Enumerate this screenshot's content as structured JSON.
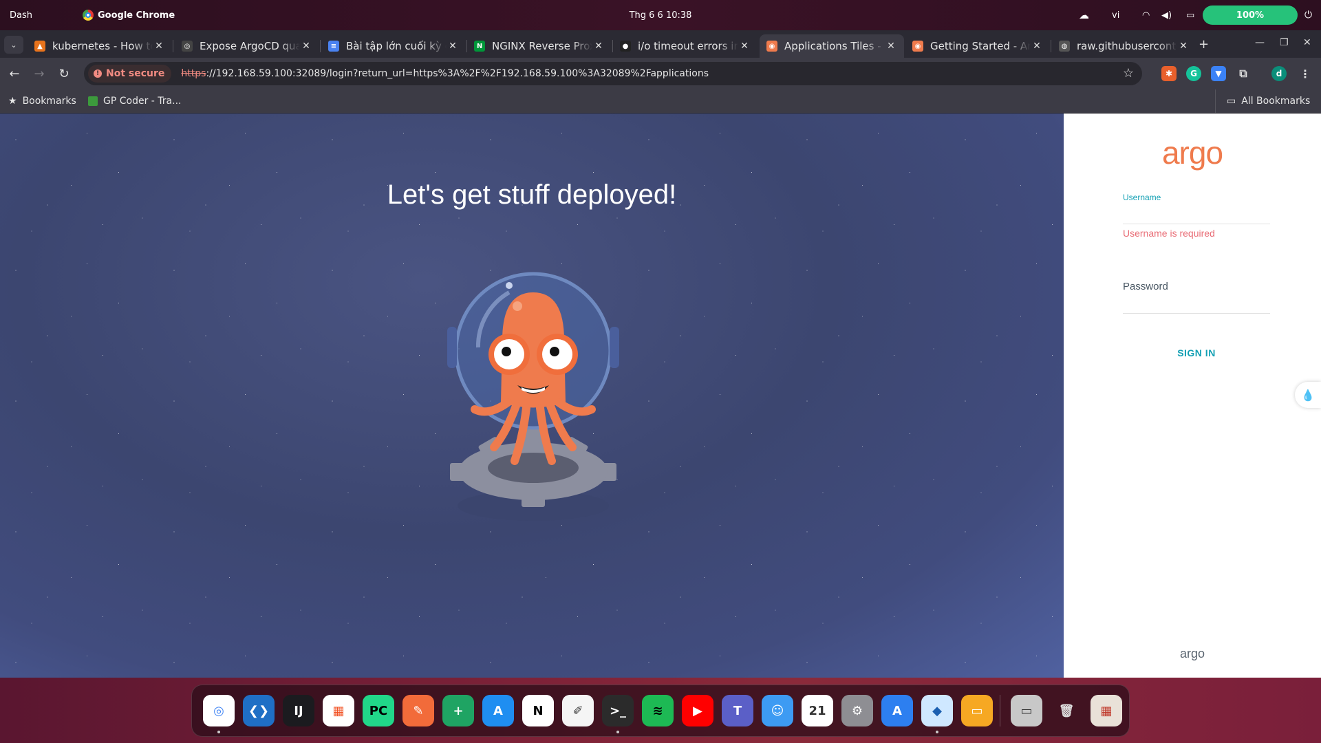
{
  "os": {
    "dash_label": "Dash",
    "app_name": "Google Chrome",
    "datetime": "Thg 6 6  10:38",
    "lang": "vi",
    "battery": "100%"
  },
  "browser": {
    "tabs": [
      {
        "title": "kubernetes - How to",
        "fav_color": "#e8731c",
        "fav_glyph": "▲"
      },
      {
        "title": "Expose ArgoCD qua Ingress",
        "fav_color": "#444",
        "fav_glyph": "◎"
      },
      {
        "title": "Bài tập lớn cuối kỳ các",
        "fav_color": "#4a82f0",
        "fav_glyph": "≡"
      },
      {
        "title": "NGINX Reverse Proxy",
        "fav_color": "#009639",
        "fav_glyph": "N"
      },
      {
        "title": "i/o timeout errors in",
        "fav_color": "#222",
        "fav_glyph": "●"
      },
      {
        "title": "Applications Tiles - Argo CD",
        "fav_color": "#ef7b4d",
        "fav_glyph": "◉"
      },
      {
        "title": "Getting Started - Argo CD",
        "fav_color": "#ef7b4d",
        "fav_glyph": "◉"
      },
      {
        "title": "raw.githubusercontent.com",
        "fav_color": "#555",
        "fav_glyph": "◍"
      }
    ],
    "active_tab": 5,
    "security_label": "Not secure",
    "url_scheme": "https",
    "url_rest": "://192.168.59.100:32089/login?return_url=https%3A%2F%2F192.168.59.100%3A32089%2Fapplications",
    "profile_initial": "d",
    "bookmarks": {
      "bookmarks_label": "Bookmarks",
      "gp_coder": "GP Coder - Tra...",
      "all_bookmarks": "All Bookmarks"
    }
  },
  "page": {
    "headline": "Let's get stuff deployed!",
    "logo_text": "argo",
    "username_label": "Username",
    "username_value": "",
    "username_error": "Username is required",
    "password_label": "Password",
    "signin_label": "SIGN IN",
    "footer_logo": "argo"
  },
  "colors": {
    "argo_orange": "#ef7b4d",
    "accent_teal": "#13a0b4",
    "error_red": "#e96d76"
  },
  "dock": [
    {
      "name": "chrome",
      "glyph": "◎",
      "bg": "#ffffff",
      "fg": "#4285f4",
      "dot": true
    },
    {
      "name": "vscode",
      "glyph": "❮❯",
      "bg": "#1f6fc5",
      "fg": "#ffffff",
      "dot": false
    },
    {
      "name": "intellij",
      "glyph": "IJ",
      "bg": "#1b1b1f",
      "fg": "#ffffff",
      "dot": false
    },
    {
      "name": "microsoft-store",
      "glyph": "▦",
      "bg": "#ffffff",
      "fg": "#f25022",
      "dot": false
    },
    {
      "name": "pycharm",
      "glyph": "PC",
      "bg": "#21d789",
      "fg": "#000000",
      "dot": false
    },
    {
      "name": "pen-tool",
      "glyph": "✎",
      "bg": "#f26b3a",
      "fg": "#ffffff",
      "dot": false
    },
    {
      "name": "sheets",
      "glyph": "+",
      "bg": "#1fa463",
      "fg": "#ffffff",
      "dot": false
    },
    {
      "name": "app-store",
      "glyph": "A",
      "bg": "#1f8ef1",
      "fg": "#ffffff",
      "dot": false
    },
    {
      "name": "notion",
      "glyph": "N",
      "bg": "#ffffff",
      "fg": "#000000",
      "dot": false
    },
    {
      "name": "notes",
      "glyph": "✐",
      "bg": "#f5f5f5",
      "fg": "#333333",
      "dot": false
    },
    {
      "name": "terminal",
      "glyph": ">_",
      "bg": "#2b2b2b",
      "fg": "#ffffff",
      "dot": true
    },
    {
      "name": "spotify",
      "glyph": "≋",
      "bg": "#1db954",
      "fg": "#000000",
      "dot": false
    },
    {
      "name": "youtube",
      "glyph": "▶",
      "bg": "#ff0000",
      "fg": "#ffffff",
      "dot": false
    },
    {
      "name": "teams",
      "glyph": "T",
      "bg": "#5b5fc7",
      "fg": "#ffffff",
      "dot": false
    },
    {
      "name": "finder",
      "glyph": "☺",
      "bg": "#3d9bf3",
      "fg": "#ffffff",
      "dot": false
    },
    {
      "name": "calendar",
      "glyph": "21",
      "bg": "#ffffff",
      "fg": "#333333",
      "dot": false
    },
    {
      "name": "settings",
      "glyph": "⚙",
      "bg": "#8e8e93",
      "fg": "#ffffff",
      "dot": false
    },
    {
      "name": "software-updater",
      "glyph": "A",
      "bg": "#2d7ff0",
      "fg": "#ffffff",
      "dot": false
    },
    {
      "name": "virtualbox",
      "glyph": "◆",
      "bg": "#cfe8ff",
      "fg": "#1b5fb0",
      "dot": true
    },
    {
      "name": "slides",
      "glyph": "▭",
      "bg": "#f6a823",
      "fg": "#ffffff",
      "dot": false
    },
    {
      "name": "disk",
      "glyph": "▭",
      "bg": "#c8c8c8",
      "fg": "#333333",
      "dot": false
    },
    {
      "name": "trash",
      "glyph": "🗑",
      "bg": "transparent",
      "fg": "#dddddd",
      "dot": false
    },
    {
      "name": "app-grid",
      "glyph": "▦",
      "bg": "#e9e1d8",
      "fg": "#c0392b",
      "dot": false
    }
  ]
}
